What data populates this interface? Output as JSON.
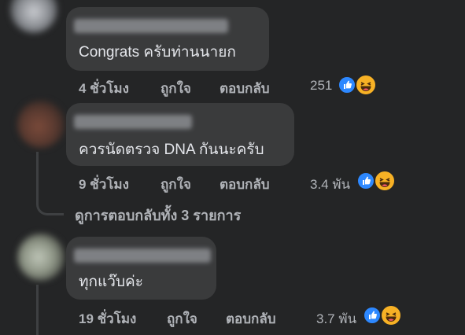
{
  "comments": [
    {
      "text": "Congrats ครับท่านนายก",
      "time": "4 ชั่วโมง",
      "like_label": "ถูกใจ",
      "reply_label": "ตอบกลับ",
      "reaction_count": "251"
    },
    {
      "text": "ควรนัดตรวจ DNA กันนะครับ",
      "time": "9 ชั่วโมง",
      "like_label": "ถูกใจ",
      "reply_label": "ตอบกลับ",
      "reaction_count": "3.4 พัน",
      "view_replies_label": "ดูการตอบกลับทั้ง 3 รายการ"
    },
    {
      "text": "ทุกแว๊บค่ะ",
      "time": "19 ชั่วโมง",
      "like_label": "ถูกใจ",
      "reply_label": "ตอบกลับ",
      "reaction_count": "3.7 พัน"
    }
  ],
  "reaction_icons": [
    "like-icon",
    "haha-icon"
  ],
  "colors": {
    "background": "#242526",
    "bubble": "#3a3b3c",
    "text_primary": "#e4e6eb",
    "text_secondary": "#b0b3b8",
    "like_blue": "#2d88ff",
    "haha_yellow": "#f7b125"
  }
}
